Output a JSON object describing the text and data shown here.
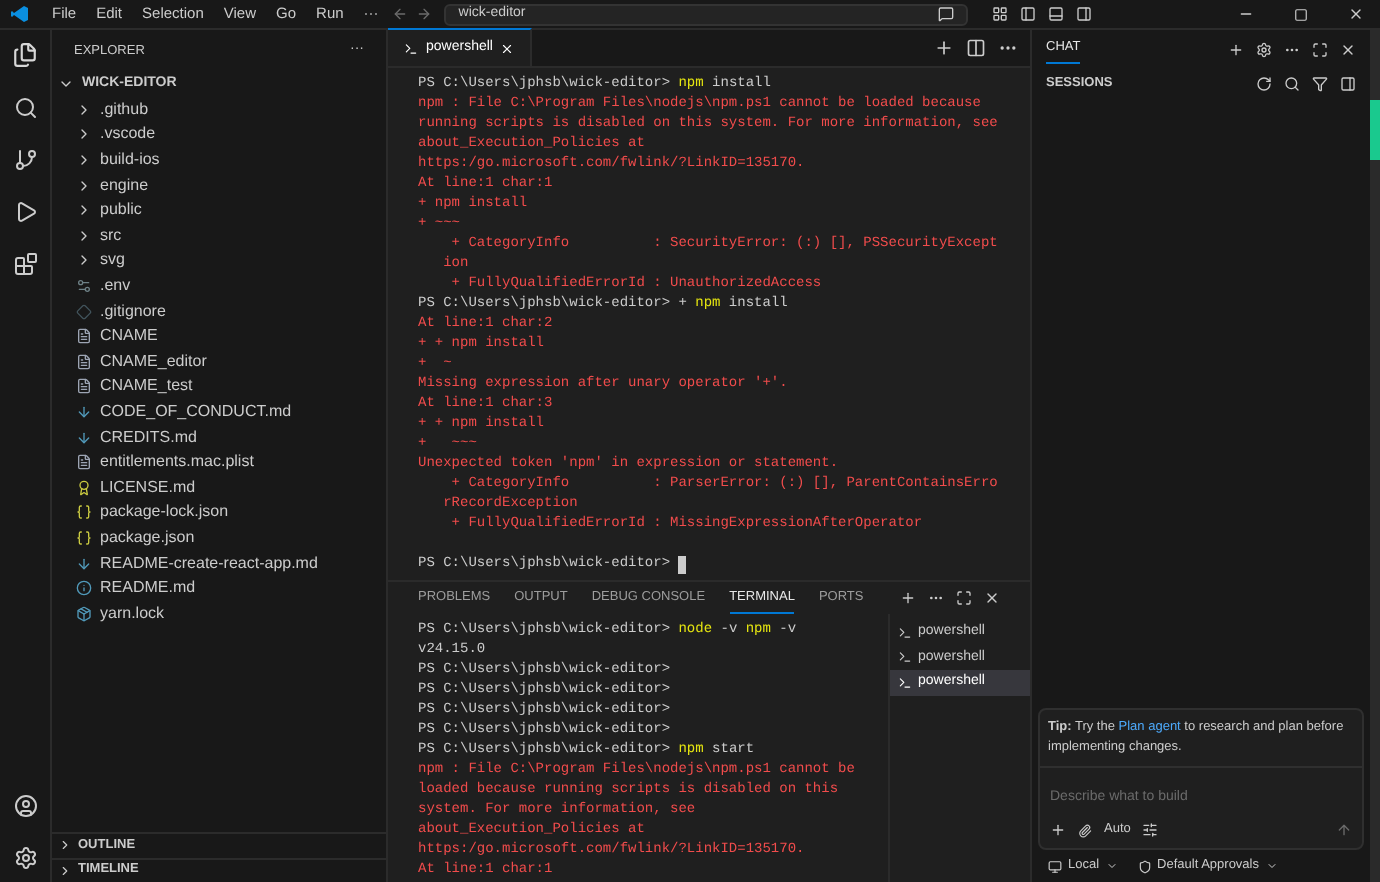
{
  "title_bar": {
    "menu": [
      "File",
      "Edit",
      "Selection",
      "View",
      "Go",
      "Run",
      "···"
    ],
    "search": "wick-editor"
  },
  "explorer": {
    "title": "EXPLORER",
    "more": "···",
    "tree": [
      {
        "label": "WICK-EDITOR",
        "kind": "root",
        "expanded": true,
        "children": [
          {
            "label": ".github",
            "kind": "folder",
            "expanded": false
          },
          {
            "label": ".vscode",
            "kind": "folder",
            "expanded": false
          },
          {
            "label": "build-ios",
            "kind": "folder",
            "expanded": false
          },
          {
            "label": "engine",
            "kind": "folder",
            "expanded": false
          },
          {
            "label": "public",
            "kind": "folder",
            "expanded": false
          },
          {
            "label": "src",
            "kind": "folder",
            "expanded": false
          },
          {
            "label": "svg",
            "kind": "folder",
            "expanded": false
          },
          {
            "label": ".env",
            "kind": "settings"
          },
          {
            "label": ".gitignore",
            "kind": "git"
          },
          {
            "label": "CNAME",
            "kind": "text"
          },
          {
            "label": "CNAME_editor",
            "kind": "text"
          },
          {
            "label": "CNAME_test",
            "kind": "text"
          },
          {
            "label": "CODE_OF_CONDUCT.md",
            "kind": "markdown"
          },
          {
            "label": "CREDITS.md",
            "kind": "markdown"
          },
          {
            "label": "entitlements.mac.plist",
            "kind": "text"
          },
          {
            "label": "LICENSE.md",
            "kind": "license"
          },
          {
            "label": "package-lock.json",
            "kind": "json"
          },
          {
            "label": "package.json",
            "kind": "json"
          },
          {
            "label": "README-create-react-app.md",
            "kind": "markdown"
          },
          {
            "label": "README.md",
            "kind": "info"
          },
          {
            "label": "yarn.lock",
            "kind": "yarn"
          }
        ]
      }
    ],
    "sections": [
      {
        "label": "OUTLINE",
        "expanded": false
      },
      {
        "label": "TIMELINE",
        "expanded": false
      }
    ]
  },
  "editor_tabs": [
    {
      "label": "powershell",
      "selected": true
    }
  ],
  "editor_terminal": [
    [
      {
        "kind": "plain",
        "text": "PS C:\\Users\\jphsb\\wick-editor> "
      },
      {
        "kind": "cmd",
        "text": "npm"
      },
      {
        "kind": "plain",
        "text": " install"
      }
    ],
    [
      {
        "kind": "error",
        "text": "npm : File C:\\Program Files\\nodejs\\npm.ps1 cannot be loaded because"
      }
    ],
    [
      {
        "kind": "error",
        "text": "running scripts is disabled on this system. For more information, see"
      }
    ],
    [
      {
        "kind": "error",
        "text": "about_Execution_Policies at"
      }
    ],
    [
      {
        "kind": "error",
        "text": "https:/go.microsoft.com/fwlink/?LinkID=135170."
      }
    ],
    [
      {
        "kind": "error",
        "text": "At line:1 char:1"
      }
    ],
    [
      {
        "kind": "error",
        "text": "+ npm install"
      }
    ],
    [
      {
        "kind": "error",
        "text": "+ ~~~"
      }
    ],
    [
      {
        "kind": "error",
        "text": "    + CategoryInfo          : SecurityError: (:) [], PSSecurityExcept"
      }
    ],
    [
      {
        "kind": "error",
        "text": "   ion"
      }
    ],
    [
      {
        "kind": "error",
        "text": "    + FullyQualifiedErrorId : UnauthorizedAccess"
      }
    ],
    [
      {
        "kind": "plain",
        "text": "PS C:\\Users\\jphsb\\wick-editor> + "
      },
      {
        "kind": "cmd",
        "text": "npm"
      },
      {
        "kind": "plain",
        "text": " install"
      }
    ],
    [
      {
        "kind": "error",
        "text": "At line:1 char:2"
      }
    ],
    [
      {
        "kind": "error",
        "text": "+ + npm install"
      }
    ],
    [
      {
        "kind": "error",
        "text": "+  ~"
      }
    ],
    [
      {
        "kind": "error",
        "text": "Missing expression after unary operator '+'."
      }
    ],
    [
      {
        "kind": "error",
        "text": "At line:1 char:3"
      }
    ],
    [
      {
        "kind": "error",
        "text": "+ + npm install"
      }
    ],
    [
      {
        "kind": "error",
        "text": "+   ~~~"
      }
    ],
    [
      {
        "kind": "error",
        "text": "Unexpected token 'npm' in expression or statement."
      }
    ],
    [
      {
        "kind": "error",
        "text": "    + CategoryInfo          : ParserError: (:) [], ParentContainsErro"
      }
    ],
    [
      {
        "kind": "error",
        "text": "   rRecordException"
      }
    ],
    [
      {
        "kind": "error",
        "text": "    + FullyQualifiedErrorId : MissingExpressionAfterOperator"
      }
    ]
  ],
  "editor_prompt": {
    "text": "PS C:\\Users\\jphsb\\wick-editor> ",
    "cursor": true
  },
  "panel_tabs": [
    {
      "label": "PROBLEMS",
      "selected": false
    },
    {
      "label": "OUTPUT",
      "selected": false
    },
    {
      "label": "DEBUG CONSOLE",
      "selected": false
    },
    {
      "label": "TERMINAL",
      "selected": true
    },
    {
      "label": "PORTS",
      "selected": false
    }
  ],
  "panel_terminal": [
    [
      {
        "kind": "plain",
        "text": "PS C:\\Users\\jphsb\\wick-editor> "
      },
      {
        "kind": "cmd",
        "text": "node"
      },
      {
        "kind": "plain",
        "text": " -v "
      },
      {
        "kind": "cmd",
        "text": "npm"
      },
      {
        "kind": "plain",
        "text": " -v"
      }
    ],
    [
      {
        "kind": "plain",
        "text": "v24.15.0"
      }
    ],
    [
      {
        "kind": "plain",
        "text": "PS C:\\Users\\jphsb\\wick-editor>"
      }
    ],
    [
      {
        "kind": "plain",
        "text": "PS C:\\Users\\jphsb\\wick-editor>"
      }
    ],
    [
      {
        "kind": "plain",
        "text": "PS C:\\Users\\jphsb\\wick-editor>"
      }
    ],
    [
      {
        "kind": "plain",
        "text": "PS C:\\Users\\jphsb\\wick-editor>"
      }
    ],
    [
      {
        "kind": "plain",
        "text": "PS C:\\Users\\jphsb\\wick-editor> "
      },
      {
        "kind": "cmd",
        "text": "npm"
      },
      {
        "kind": "plain",
        "text": " start"
      }
    ],
    [
      {
        "kind": "error",
        "text": "npm : File C:\\Program Files\\nodejs\\npm.ps1 cannot be"
      }
    ],
    [
      {
        "kind": "error",
        "text": "loaded because running scripts is disabled on this"
      }
    ],
    [
      {
        "kind": "error",
        "text": "system. For more information, see"
      }
    ],
    [
      {
        "kind": "error",
        "text": "about_Execution_Policies at"
      }
    ],
    [
      {
        "kind": "error",
        "text": "https:/go.microsoft.com/fwlink/?LinkID=135170."
      }
    ],
    [
      {
        "kind": "error",
        "text": "At line:1 char:1"
      }
    ]
  ],
  "terminals": [
    {
      "label": "powershell",
      "selected": false
    },
    {
      "label": "powershell",
      "selected": false
    },
    {
      "label": "powershell",
      "selected": true
    }
  ],
  "chat": {
    "tabs": [
      {
        "label": "CHAT",
        "selected": true
      }
    ],
    "sessions": "SESSIONS",
    "tip": "**Tip:** Try the ",
    "tip_link": "Plan agent",
    "tip_rest": " to research and plan before implementing changes.",
    "input": {
      "placeholder": "Describe what to build"
    },
    "mode": "Auto",
    "footer": [
      "Local",
      "Default Approvals"
    ]
  }
}
